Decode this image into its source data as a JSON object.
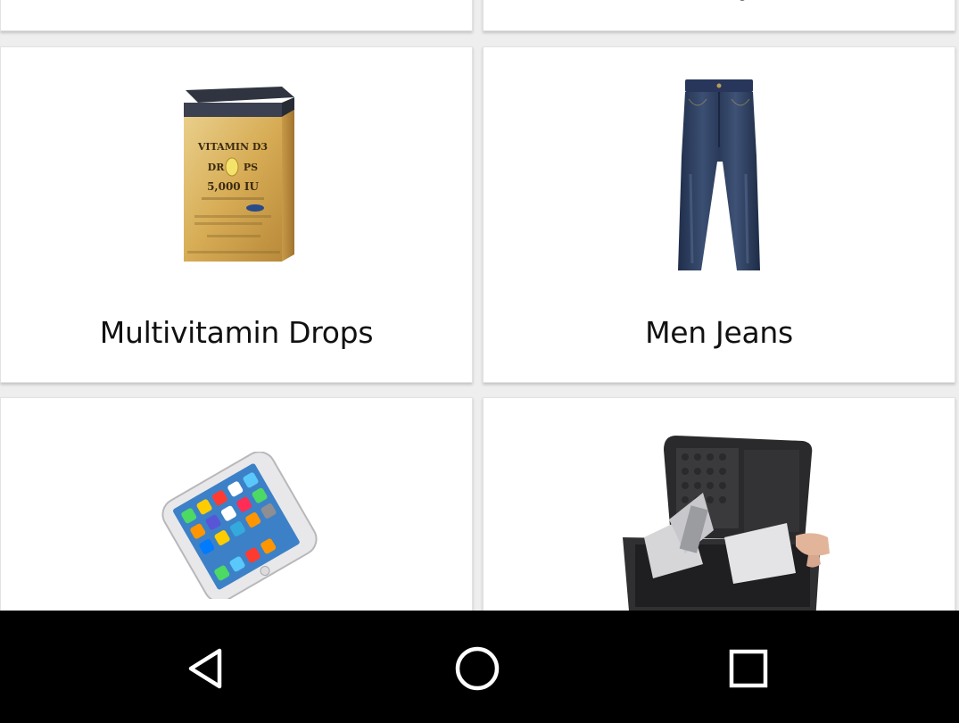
{
  "grid": {
    "products": [
      {
        "name": "",
        "image_icon": "product-image"
      },
      {
        "name": "",
        "image_icon": "product-image"
      },
      {
        "name": "Multivitamin Drops",
        "image_icon": "vitamin-d3-drops-box"
      },
      {
        "name": "Men Jeans",
        "image_icon": "blue-jeans"
      },
      {
        "name": "",
        "image_icon": "white-smartphone"
      },
      {
        "name": "",
        "image_icon": "equipment-case"
      }
    ],
    "vitamin_box_text": {
      "line1": "VITAMIN D3",
      "line2a": "DR",
      "line2b": "PS",
      "line3": "5,000 IU"
    }
  },
  "navbar": {
    "back_icon": "triangle-back-icon",
    "home_icon": "circle-home-icon",
    "recents_icon": "square-recents-icon"
  },
  "colors": {
    "background": "#eeeeee",
    "card": "#ffffff",
    "navbar": "#000000",
    "nav_icon": "#ffffff"
  }
}
